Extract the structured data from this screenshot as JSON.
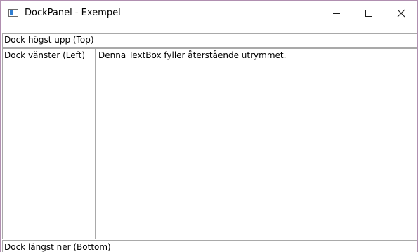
{
  "window": {
    "title": "DockPanel - Exempel",
    "icon": "application-window-icon",
    "controls": {
      "minimize_icon": "minimize-icon",
      "maximize_icon": "maximize-icon",
      "close_icon": "close-icon"
    }
  },
  "dock_panel": {
    "top": "Dock högst upp (Top)",
    "left": "Dock vänster (Left)",
    "fill": "Denna TextBox fyller återstående utrymmet.",
    "bottom": "Dock längst ner (Bottom)"
  },
  "colors": {
    "window_border": "#b08fb0",
    "textbox_border": "#a9a9a9",
    "icon_accent": "#2e7dd1"
  }
}
